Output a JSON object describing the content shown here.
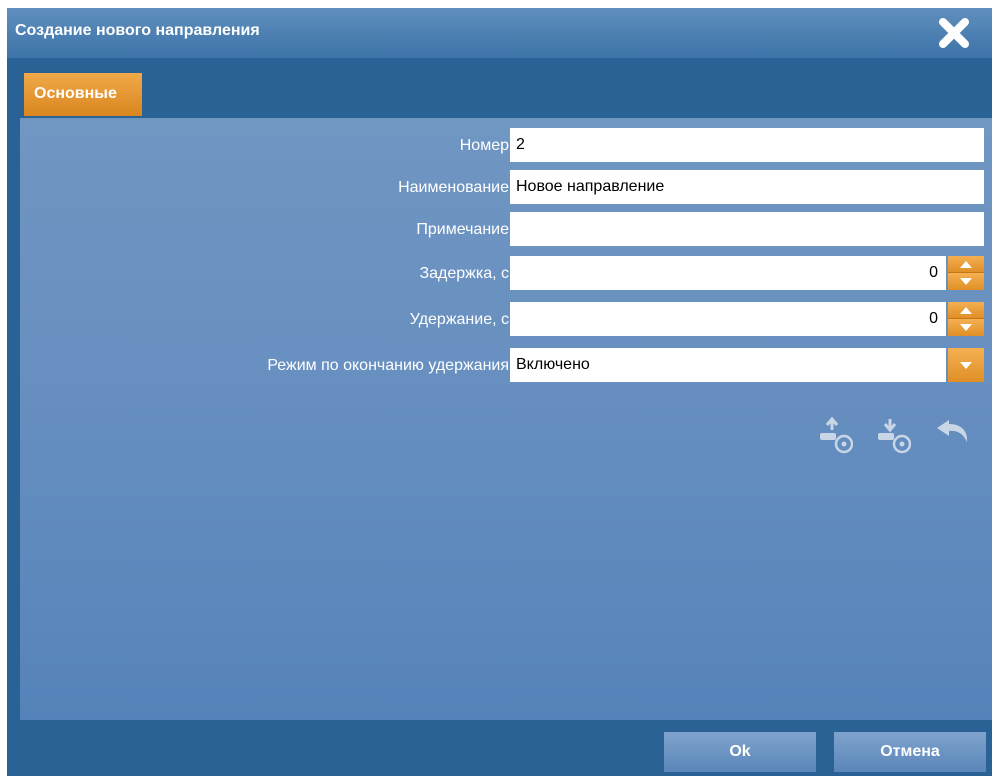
{
  "dialog": {
    "title": "Создание нового направления",
    "close_icon": "close-icon"
  },
  "tabs": [
    {
      "label": "Основные",
      "active": true
    }
  ],
  "form": {
    "number": {
      "label": "Номер",
      "value": "2"
    },
    "name": {
      "label": "Наименование",
      "value": "Новое направление"
    },
    "note": {
      "label": "Примечание",
      "value": ""
    },
    "delay": {
      "label": "Задержка, с",
      "value": "0"
    },
    "hold": {
      "label": "Удержание, с",
      "value": "0"
    },
    "mode_after_hold": {
      "label": "Режим по окончанию удержания",
      "value": "Включено"
    }
  },
  "toolbar": {
    "icons": [
      "upload-icon",
      "download-icon",
      "undo-icon"
    ]
  },
  "footer": {
    "ok_label": "Ok",
    "cancel_label": "Отмена"
  },
  "colors": {
    "accent": "#e8962f",
    "dialog_bg": "#2a6296",
    "panel_bg": "#6890c0"
  }
}
